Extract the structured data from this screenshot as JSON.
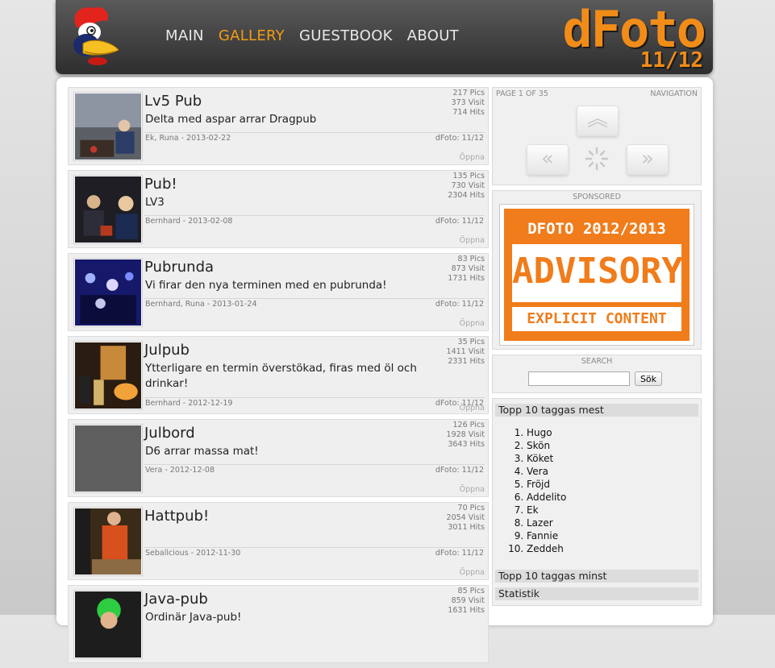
{
  "header": {
    "brand_title": "dFoto",
    "brand_season": "11/12",
    "nav": [
      "MAIN",
      "GALLERY",
      "GUESTBOOK",
      "ABOUT"
    ],
    "active_nav": "GALLERY",
    "accent": "#f39c12"
  },
  "albums": [
    {
      "title": "Lv5 Pub",
      "desc": "Delta med aspar arrar Dragpub",
      "pics": "217 Pics",
      "visit": "373 Visit",
      "hits": "714 Hits",
      "meta": "Ek, Runa - 2013-02-22",
      "source": "dFoto: 11/12",
      "open": "Öppna"
    },
    {
      "title": "Pub!",
      "desc": "LV3",
      "pics": "135 Pics",
      "visit": "730 Visit",
      "hits": "2304 Hits",
      "meta": "Bernhard - 2013-02-08",
      "source": "dFoto: 11/12",
      "open": "Öppna"
    },
    {
      "title": "Pubrunda",
      "desc": "Vi firar den nya terminen med en pubrunda!",
      "pics": "83 Pics",
      "visit": "873 Visit",
      "hits": "1731 Hits",
      "meta": "Bernhard, Runa - 2013-01-24",
      "source": "dFoto: 11/12",
      "open": "Öppna"
    },
    {
      "title": "Julpub",
      "desc": "Ytterligare en termin överstökad, firas med öl och drinkar!",
      "pics": "35 Pics",
      "visit": "1411 Visit",
      "hits": "2331 Hits",
      "meta": "Bernhard - 2012-12-19",
      "source": "dFoto: 11/12",
      "open": "Öppna"
    },
    {
      "title": "Julbord",
      "desc": "D6 arrar massa mat!",
      "pics": "126 Pics",
      "visit": "1928 Visit",
      "hits": "3643 Hits",
      "meta": "Vera - 2012-12-08",
      "source": "dFoto: 11/12",
      "open": "Öppna"
    },
    {
      "title": "Hattpub!",
      "desc": "",
      "pics": "70 Pics",
      "visit": "2054 Visit",
      "hits": "3011 Hits",
      "meta": "Seballcious - 2012-11-30",
      "source": "dFoto: 11/12",
      "open": "Öppna"
    },
    {
      "title": "Java-pub",
      "desc": "Ordinär Java-pub!",
      "pics": "85 Pics",
      "visit": "859 Visit",
      "hits": "1631 Hits",
      "meta": "",
      "source": "",
      "open": ""
    }
  ],
  "sidebar": {
    "page_label": "PAGE 1 OF 35",
    "nav_label": "NAVIGATION",
    "sponsored_label": "SPONSORED",
    "ad": {
      "line1": "DFOTO 2012/2013",
      "line2": "ADVISORY",
      "line3": "EXPLICIT CONTENT"
    },
    "search_label": "SEARCH",
    "search_button": "Sök",
    "search_value": "",
    "top_tagged_title": "Topp 10 taggas mest",
    "top_tagged": [
      "Hugo",
      "Skön",
      "Köket",
      "Vera",
      "Fröjd",
      "Addelito",
      "Ek",
      "Lazer",
      "Fannie",
      "Zeddeh"
    ],
    "least_tagged_title": "Topp 10 taggas minst",
    "stats_title": "Statistik"
  }
}
